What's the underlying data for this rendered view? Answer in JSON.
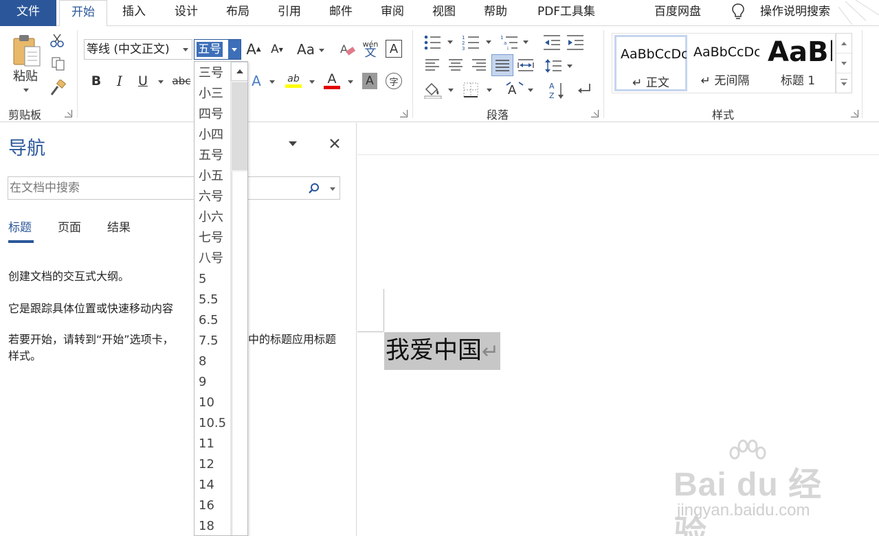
{
  "tabs": [
    "文件",
    "开始",
    "插入",
    "设计",
    "布局",
    "引用",
    "邮件",
    "审阅",
    "视图",
    "帮助",
    "PDF工具集",
    "百度网盘"
  ],
  "tell_me": "操作说明搜索",
  "clipboard": {
    "paste_label": "粘贴",
    "group_label": "剪贴板"
  },
  "font": {
    "name": "等线 (中文正文)",
    "size": "五号",
    "grow_label": "A",
    "shrink_label": "A",
    "case_label": "Aa",
    "phonetic_top": "wén",
    "phonetic_bottom": "文",
    "border_char": "A",
    "bold": "B",
    "italic": "I",
    "underline": "U",
    "strike": "abc",
    "color_char": "A",
    "shade_char": "A",
    "enclose_char": "字",
    "highlight_char": "ab"
  },
  "paragraph": {
    "group_label": "段落"
  },
  "styles": {
    "group_label": "样式",
    "items": [
      {
        "preview": "AaBbCcDc",
        "name": "↵ 正文"
      },
      {
        "preview": "AaBbCcDc",
        "name": "↵ 无间隔"
      },
      {
        "preview": "AaBb",
        "name": "标题 1"
      }
    ]
  },
  "nav": {
    "title": "导航",
    "search_placeholder": "在文档中搜索",
    "tabs": [
      "标题",
      "页面",
      "结果"
    ],
    "line1": "创建文档的交互式大纲。",
    "line2": "它是跟踪具体位置或快速移动内容",
    "line3": "若要开始，请转到“开始”选项卡，",
    "line3b": "中的标题应用标题",
    "line4": "样式。"
  },
  "font_sizes": [
    "三号",
    "小三",
    "四号",
    "小四",
    "五号",
    "小五",
    "六号",
    "小六",
    "七号",
    "八号",
    "5",
    "5.5",
    "6.5",
    "7.5",
    "8",
    "9",
    "10",
    "10.5",
    "11",
    "12",
    "14",
    "16",
    "18"
  ],
  "document": {
    "text": "我爱中国",
    "para_mark": "↵"
  },
  "watermark": {
    "main": "Bai du 经验",
    "sub": "jingyan.baidu.com"
  },
  "colors": {
    "accent": "#2b579a",
    "highlight": "#ffff00",
    "font_color": "#e00000"
  }
}
